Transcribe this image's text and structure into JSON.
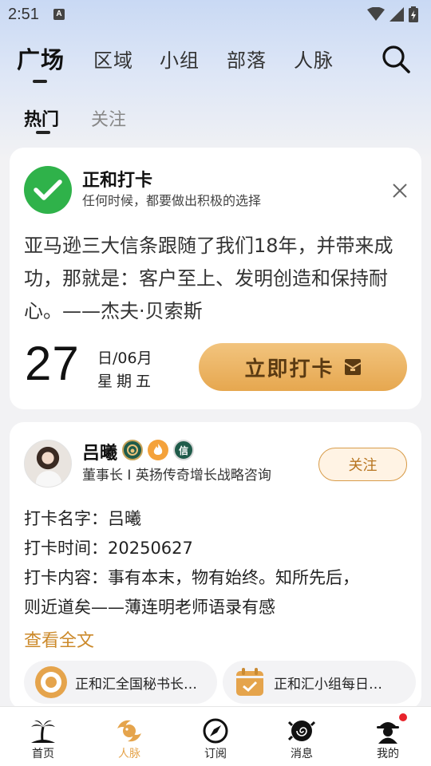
{
  "status": {
    "time": "2:51",
    "indicator": "A"
  },
  "nav": {
    "items": [
      "广场",
      "区域",
      "小组",
      "部落",
      "人脉"
    ],
    "active": "广场"
  },
  "sub_nav": {
    "items": [
      "热门",
      "关注"
    ],
    "active": "热门"
  },
  "checkin_card": {
    "title": "正和打卡",
    "subtitle": "任何时候，都要做出积极的选择",
    "quote": "亚马逊三大信条跟随了我们18年，并带来成功，那就是：客户至上、发明创造和保持耐心。——杰夫·贝索斯",
    "day": "27",
    "month_line": "日/06月",
    "week_line": "星期五",
    "button_label": "立即打卡"
  },
  "post": {
    "user_name": "吕曦",
    "badge3_char": "信",
    "user_title": "董事长 I 英扬传奇增长战略咨询",
    "follow_label": "关注",
    "line1": "打卡名字：吕曦",
    "line2": "打卡时间：20250627",
    "line3": "打卡内容：事有本末，物有始终。知所先后，",
    "line4": "则近道矣——薄连明老师语录有感",
    "read_more": "查看全文",
    "tags": [
      "正和汇全国秘书长…",
      "正和汇小组每日…"
    ]
  },
  "tabbar": {
    "items": [
      "首页",
      "人脉",
      "订阅",
      "消息",
      "我的"
    ],
    "active": "人脉"
  },
  "colors": {
    "accent": "#e5a44c",
    "check_green": "#2fb24a",
    "notification_dot": "#e8232b"
  }
}
